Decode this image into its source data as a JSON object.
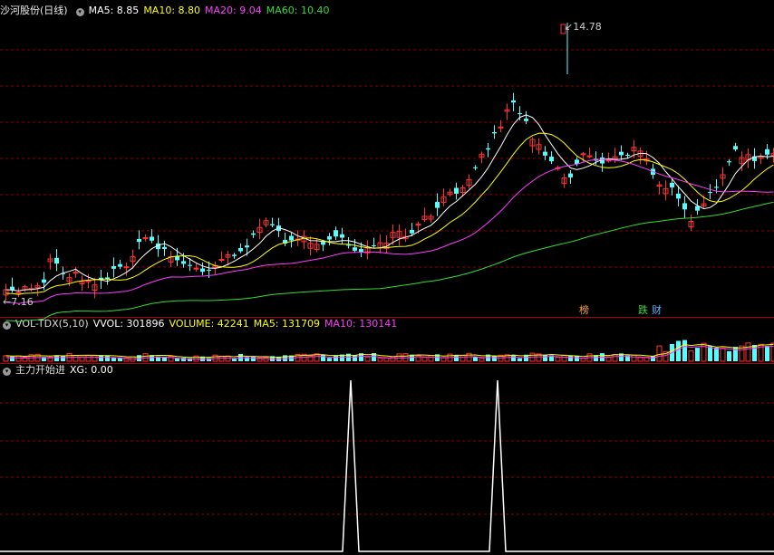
{
  "main_chart": {
    "stock_name": "沙河股份",
    "period": "(日线)",
    "indicators": [
      {
        "label": "MA5: 8.85",
        "color": "#ffffff"
      },
      {
        "label": "MA10: 8.80",
        "color": "#ffff00"
      },
      {
        "label": "MA20: 9.04",
        "color": "#ff3cff"
      },
      {
        "label": "MA60: 10.40",
        "color": "#33dd33"
      }
    ],
    "high_marker": "14.78",
    "low_marker": "7.16",
    "events": [
      {
        "label": "榜",
        "color": "#ff9a3c"
      },
      {
        "label": "跌",
        "color": "#33dd33"
      },
      {
        "label": "财",
        "color": "#5fb4ff"
      }
    ]
  },
  "volume_panel": {
    "indicator_name": "VOL-TDX(5,10)",
    "values": [
      {
        "label": "VVOL: 301896",
        "color": "#ffffff"
      },
      {
        "label": "VOLUME: 42241",
        "color": "#ffff00"
      },
      {
        "label": "MA5: 131709",
        "color": "#ffff00"
      },
      {
        "label": "MA10: 130141",
        "color": "#ff3cff"
      }
    ]
  },
  "signal_panel": {
    "indicator_name": "主力开始进",
    "values": [
      {
        "label": "XG: 0.00",
        "color": "#ffffff"
      }
    ]
  },
  "colors": {
    "up": "#ff3333",
    "down": "#55ffff",
    "ma5": "#ffffff",
    "ma10": "#ffff00",
    "ma20": "#ff3cff",
    "ma60": "#33dd33",
    "grid": "#8b0000",
    "divider": "#b00000"
  }
}
